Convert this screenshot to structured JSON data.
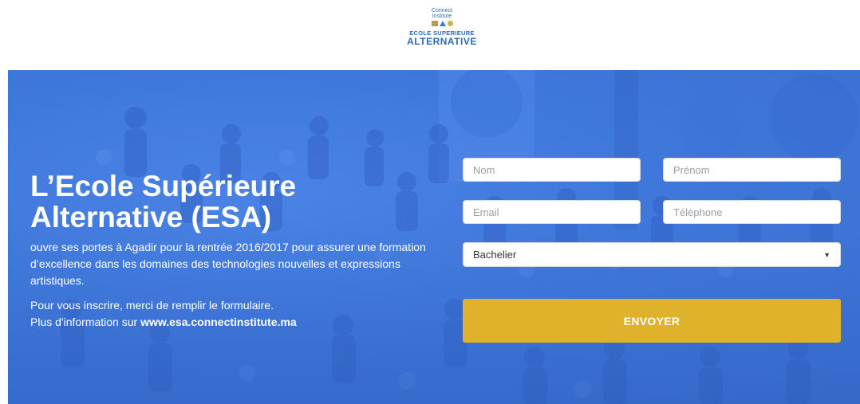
{
  "logo": {
    "top_line1": "Connect",
    "top_line2": "Institute",
    "line1": "ECOLE SUPERIEURE",
    "line2": "ALTERNATIVE"
  },
  "hero": {
    "title_line1": "L’Ecole Supérieure",
    "title_line2": "Alternative (ESA)",
    "paragraph": "ouvre ses portes à Agadir pour la rentrée 2016/2017 pour assurer une formation d’excellence dans les domaines des technologies nouvelles et expressions artistiques.",
    "cta_line1": "Pour vous inscrire, merci de remplir le formulaire.",
    "cta_line2_prefix": "Plus d'information sur ",
    "cta_link": "www.esa.connectinstitute.ma"
  },
  "form": {
    "nom_placeholder": "Nom",
    "prenom_placeholder": "Prénom",
    "email_placeholder": "Email",
    "telephone_placeholder": "Téléphone",
    "level_selected": "Bachelier",
    "submit_label": "ENVOYER"
  },
  "colors": {
    "overlay_blue": "#3f78db",
    "button_gold": "#e0b12a",
    "logo_blue": "#2d6bb5"
  },
  "icons": {
    "select_caret": "chevron-down-icon"
  }
}
